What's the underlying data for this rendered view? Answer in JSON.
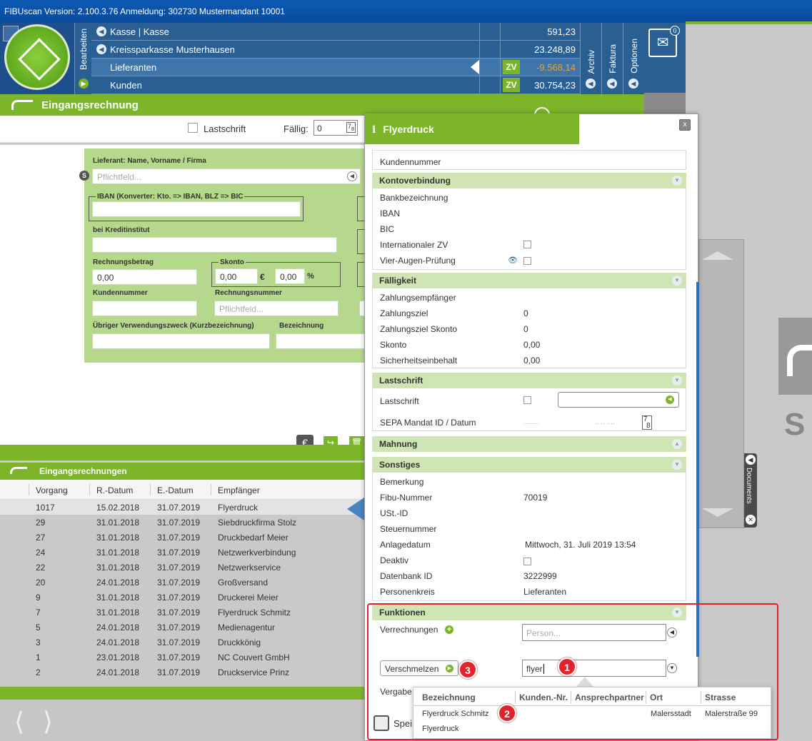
{
  "app": {
    "title": "FIBUscan Version: 2.100.3.76 Anmeldung: 302730 Mustermandant 10001"
  },
  "nav": {
    "bearbeiten": "Bearbeiten",
    "archiv": "Archiv",
    "faktura": "Faktura",
    "optionen": "Optionen",
    "mail_count": "0",
    "accounts": [
      {
        "name": "Kasse | Kasse",
        "amount": "591,23",
        "zv": ""
      },
      {
        "name": "Kreissparkasse Musterhausen",
        "amount": "23.248,89",
        "zv": ""
      },
      {
        "name": "Lieferanten",
        "amount": "-9.568,14",
        "zv": "ZV"
      },
      {
        "name": "Kunden",
        "amount": "30.754,23",
        "zv": "ZV"
      }
    ]
  },
  "er": {
    "title": "Eingangsrechnung",
    "lastschrift_label": "Lastschrift",
    "faellig_label": "Fällig:",
    "faellig_value": "0",
    "form": {
      "lieferant_label": "Lieferant: Name, Vorname / Firma",
      "lieferant_placeholder": "Pflichtfeld...",
      "iban_label": "IBAN (Konverter: Kto. => IBAN, BLZ => BIC",
      "kredit_label": "bei Kreditinstitut",
      "betrag_label": "Rechnungsbetrag",
      "betrag_value": "0,00",
      "skonto_label": "Skonto",
      "skonto_value": "0,00",
      "skonto_unit": "€",
      "skonto_pct_value": "0,00",
      "skonto_pct_unit": "%",
      "kundennr_label": "Kundennummer",
      "rechnungsnr_label": "Rechnungsnummer",
      "rechnungsnr_placeholder": "Pflichtfeld...",
      "zweck_label": "Übriger Verwendungszweck (Kurzbezeichnung)",
      "bezeichnung_label": "Bezeichnung"
    }
  },
  "list": {
    "title": "Eingangsrechnungen",
    "columns": [
      "Vorgang",
      "R.-Datum",
      "E.-Datum",
      "Empfänger"
    ],
    "rows": [
      [
        "1017",
        "15.02.2018",
        "31.07.2019",
        "Flyerdruck"
      ],
      [
        "29",
        "31.01.2018",
        "31.07.2019",
        "Siebdruckfirma Stolz"
      ],
      [
        "27",
        "31.01.2018",
        "31.07.2019",
        "Druckbedarf Meier"
      ],
      [
        "24",
        "31.01.2018",
        "31.07.2019",
        "Netzwerkverbindung"
      ],
      [
        "22",
        "31.01.2018",
        "31.07.2019",
        "Netzwerkservice"
      ],
      [
        "20",
        "24.01.2018",
        "31.07.2019",
        "Großversand"
      ],
      [
        "9",
        "31.01.2018",
        "31.07.2019",
        "Druckerei Meier"
      ],
      [
        "7",
        "31.01.2018",
        "31.07.2019",
        "Flyerdruck Schmitz"
      ],
      [
        "5",
        "24.01.2018",
        "31.07.2019",
        "Medienagentur"
      ],
      [
        "3",
        "24.01.2018",
        "31.07.2019",
        "Druckkönig"
      ],
      [
        "1",
        "23.01.2018",
        "31.07.2019",
        "NC Couvert GmbH"
      ],
      [
        "2",
        "24.01.2018",
        "31.07.2019",
        "Druckservice Prinz"
      ]
    ]
  },
  "modal": {
    "title": "Flyerdruck",
    "close": "x",
    "kundennummer": "Kundennummer",
    "kontoverbindung": {
      "title": "Kontoverbindung",
      "bank": "Bankbezeichnung",
      "iban": "IBAN",
      "bic": "BIC",
      "intl": "Internationaler ZV",
      "vier": "Vier-Augen-Prüfung"
    },
    "faelligkeit": {
      "title": "Fälligkeit",
      "rows": [
        {
          "label": "Zahlungsempfänger",
          "value": ""
        },
        {
          "label": "Zahlungsziel",
          "value": "0"
        },
        {
          "label": "Zahlungsziel Skonto",
          "value": "0"
        },
        {
          "label": "Skonto",
          "value": "0,00"
        },
        {
          "label": "Sicherheitseinbehalt",
          "value": "0,00"
        }
      ]
    },
    "lastschrift": {
      "title": "Lastschrift",
      "label": "Lastschrift",
      "sepa": "SEPA Mandat ID / Datum",
      "sepa_dots1": "........",
      "sepa_dots2": ".. .. ....",
      "cal_top": "7",
      "cal_bottom": "8"
    },
    "mahnung": {
      "title": "Mahnung"
    },
    "sonstiges": {
      "title": "Sonstiges",
      "rows": [
        {
          "label": "Bemerkung",
          "value": ""
        },
        {
          "label": "Fibu-Nummer",
          "value": "70019"
        },
        {
          "label": "USt.-ID",
          "value": ""
        },
        {
          "label": "Steuernummer",
          "value": ""
        },
        {
          "label": "Anlagedatum",
          "value": "Mittwoch, 31. Juli 2019 13:54"
        },
        {
          "label": "Deaktiv",
          "value": ""
        },
        {
          "label": "Datenbank ID",
          "value": "3222999"
        },
        {
          "label": "Personenkreis",
          "value": "Lieferanten"
        }
      ]
    },
    "funktionen": {
      "title": "Funktionen",
      "verrechnungen": "Verrechnungen",
      "person_placeholder": "Person...",
      "verschmelzen": "Verschmelzen",
      "search_value": "flyer",
      "vergabe": "Vergabe",
      "save": "Spei"
    }
  },
  "dropdown": {
    "columns": [
      "Bezeichnung",
      "Kunden.-Nr.",
      "Ansprechpartner",
      "Ort",
      "Strasse"
    ],
    "rows": [
      {
        "bezeichnung": "Flyerdruck Schmitz",
        "kundennr": "",
        "ansprechpartner": "",
        "ort": "Malersstadt",
        "strasse": "Malerstraße 99"
      },
      {
        "bezeichnung": "Flyerdruck",
        "kundennr": "",
        "ansprechpartner": "",
        "ort": "",
        "strasse": ""
      }
    ]
  },
  "badges": [
    "1",
    "2",
    "3"
  ],
  "side": {
    "documents": "Documents",
    "big_letter": "S"
  },
  "colors": {
    "green": "#7cb52a",
    "blue": "#2a5f93",
    "red": "#e0242a"
  }
}
